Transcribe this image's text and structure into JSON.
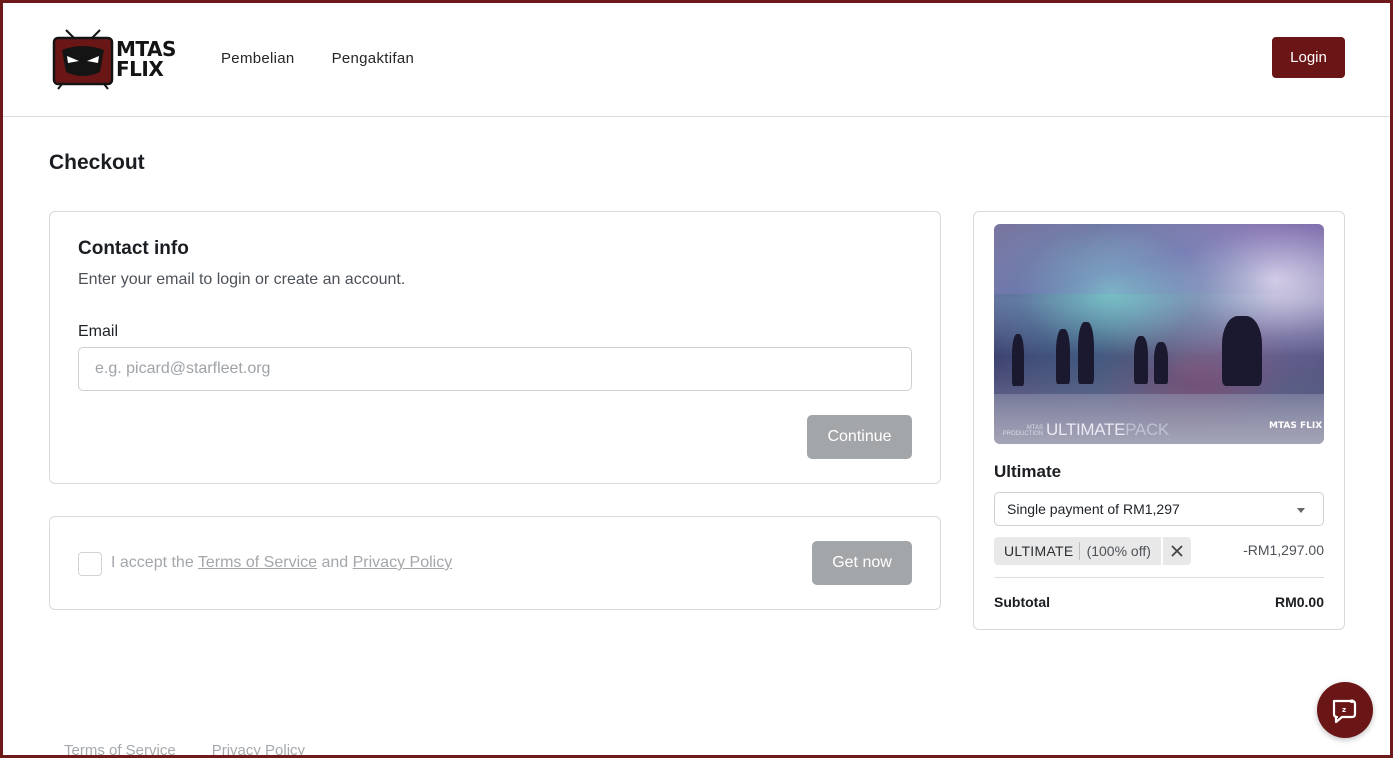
{
  "brand": {
    "logo_line1": "MTAS",
    "logo_line2": "FLIX",
    "accent_color": "#6b1616"
  },
  "nav": {
    "items": [
      {
        "label": "Pembelian"
      },
      {
        "label": "Pengaktifan"
      }
    ],
    "login_label": "Login"
  },
  "page": {
    "title": "Checkout"
  },
  "contact": {
    "title": "Contact info",
    "subtitle": "Enter your email to login or create an account.",
    "email_label": "Email",
    "email_placeholder": "e.g. picard@starfleet.org",
    "email_value": "",
    "continue_label": "Continue"
  },
  "terms": {
    "prefix": "I accept the",
    "tos_link": "Terms of Service",
    "and": "and",
    "privacy_link": "Privacy Policy",
    "checked": false,
    "get_now_label": "Get now"
  },
  "summary": {
    "image_caption_small": "MTAS PRODUCTION",
    "image_caption_main": "ULTIMATE",
    "image_caption_suffix": "PACK",
    "image_logo": "MTAS FLIX",
    "product_name": "Ultimate",
    "plan_selected": "Single payment of RM1,297",
    "coupon_code": "ULTIMATE",
    "coupon_off": "(100% off)",
    "discount": "-RM1,297.00",
    "subtotal_label": "Subtotal",
    "subtotal_value": "RM0.00"
  },
  "footer": {
    "links": [
      {
        "label": "Terms of Service"
      },
      {
        "label": "Privacy Policy"
      }
    ]
  },
  "icons": {
    "chat": "chat-bubble-icon",
    "coupon_remove": "close-icon",
    "select": "chevron-down-icon",
    "logo": "tv-mascot-icon"
  }
}
